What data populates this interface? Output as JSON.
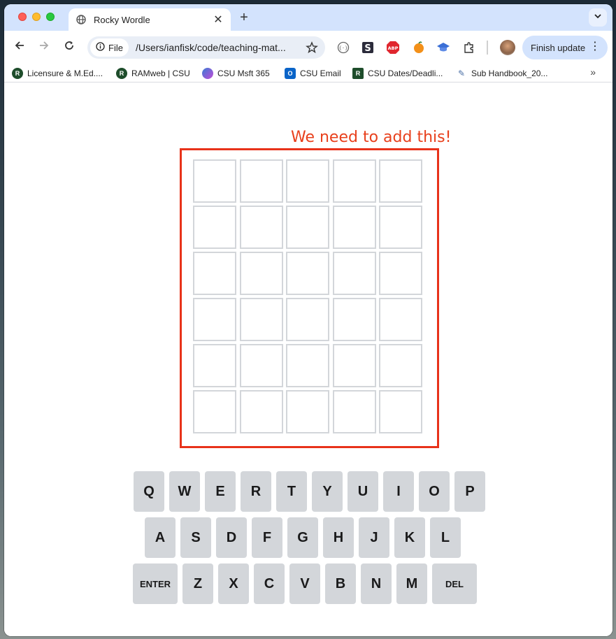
{
  "browser": {
    "tab_title": "Rocky Wordle",
    "new_tab_symbol": "+",
    "omnibox_chip": "File",
    "url": "/Users/ianfisk/code/teaching-mat...",
    "finish_update_label": "Finish update",
    "bookmarks": [
      {
        "label": "Licensure & M.Ed....",
        "icon": "csu-ram-icon",
        "color": "#1e4d2b"
      },
      {
        "label": "RAMweb | CSU",
        "icon": "csu-ram-icon",
        "color": "#1e4d2b"
      },
      {
        "label": "CSU Msft 365",
        "icon": "microsoft-365-icon",
        "color": "#7b5cd6"
      },
      {
        "label": "CSU Email",
        "icon": "outlook-icon",
        "color": "#0a64c8"
      },
      {
        "label": "CSU Dates/Deadli...",
        "icon": "csu-ram-icon",
        "color": "#1e4d2b"
      },
      {
        "label": "Sub Handbook_20...",
        "icon": "document-icon",
        "color": "#4a6fa5"
      }
    ],
    "extensions": [
      "json-viewer-icon",
      "s-extension-icon",
      "adblock-plus-icon",
      "orange-extension-icon",
      "graduation-cap-icon",
      "puzzle-icon"
    ]
  },
  "page": {
    "annotation": "We need to add this!",
    "grid": {
      "rows": 6,
      "cols": 5
    },
    "keyboard": {
      "row1": [
        "Q",
        "W",
        "E",
        "R",
        "T",
        "Y",
        "U",
        "I",
        "O",
        "P"
      ],
      "row2": [
        "A",
        "S",
        "D",
        "F",
        "G",
        "H",
        "J",
        "K",
        "L"
      ],
      "row3": [
        "ENTER",
        "Z",
        "X",
        "C",
        "V",
        "B",
        "N",
        "M",
        "DEL"
      ]
    }
  },
  "colors": {
    "accent_red": "#e8321a",
    "key_bg": "#d3d6da",
    "tab_strip": "#d3e3fd"
  }
}
